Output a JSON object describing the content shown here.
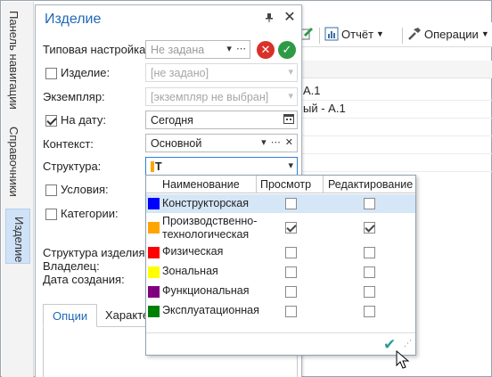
{
  "side_tabs": [
    "Панель навигации",
    "Справочники",
    "Изделие"
  ],
  "toolbar": {
    "report_label": "Отчёт",
    "operations_label": "Операции"
  },
  "bg_rows": [
    "А.1",
    "ый - А.1"
  ],
  "panel": {
    "title": "Изделие",
    "fields": {
      "preset_label": "Типовая настройка:",
      "preset_value": "Не задана",
      "product_label": "Изделие:",
      "product_value": "[не задано]",
      "instance_label": "Экземпляр:",
      "instance_value": "[экземпляр не выбран]",
      "date_label": "На дату:",
      "date_value": "Сегодня",
      "context_label": "Контекст:",
      "context_value": "Основной",
      "structure_label": "Структура:",
      "structure_value": "Т",
      "conditions_label": "Условия:",
      "categories_label": "Категории:",
      "product_structure_label": "Структура изделия:",
      "owner_label": "Владелец:",
      "created_label": "Дата создания:"
    },
    "tabs": [
      "Опции",
      "Характе"
    ]
  },
  "dropdown": {
    "columns": [
      "Наименование",
      "Просмотр",
      "Редактирование"
    ],
    "rows": [
      {
        "name": "Конструкторская",
        "color": "#0000ff",
        "view": false,
        "edit": false
      },
      {
        "name": "Производственно-технологическая",
        "color": "#ffa500",
        "view": true,
        "edit": true
      },
      {
        "name": "Физическая",
        "color": "#ff0000",
        "view": false,
        "edit": false
      },
      {
        "name": "Зональная",
        "color": "#ffff00",
        "view": false,
        "edit": false
      },
      {
        "name": "Функциональная",
        "color": "#800080",
        "view": false,
        "edit": false
      },
      {
        "name": "Эксплуатационная",
        "color": "#008000",
        "view": false,
        "edit": false
      }
    ]
  }
}
